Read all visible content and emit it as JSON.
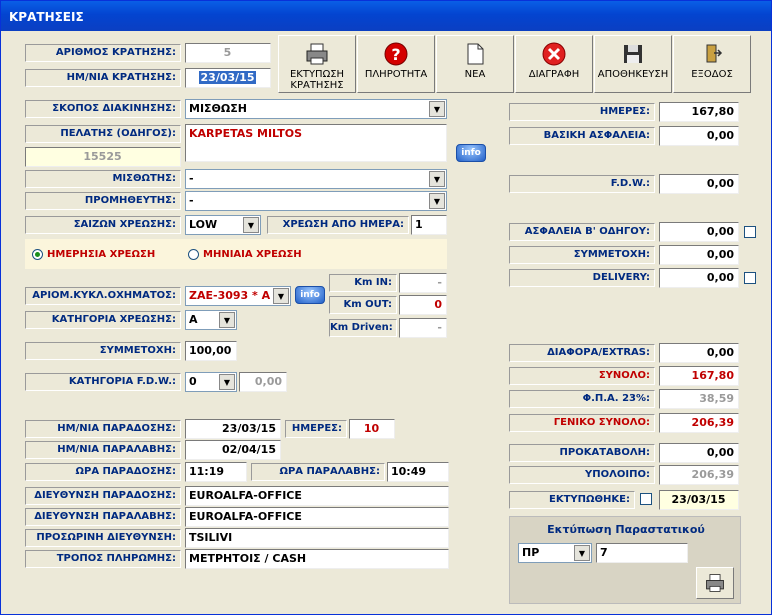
{
  "window": {
    "title": "ΚΡΑΤΗΣΕΙΣ"
  },
  "toolbar": {
    "print": "ΕΚΤΥΠΩΣΗ ΚΡΑΤΗΣΗΣ",
    "help": "ΠΛΗΡΟΤΗΤΑ",
    "new": "ΝΕΑ",
    "delete": "ΔΙΑΓΡΑΦΗ",
    "save": "ΑΠΟΘΗΚΕΥΣΗ",
    "exit": "ΕΞΟΔΟΣ"
  },
  "booking": {
    "num_label": "ΑΡΙΘΜΟΣ ΚΡΑΤΗΣΗΣ:",
    "num": "5",
    "date_label": "ΗΜ/ΝΙΑ ΚΡΑΤΗΣΗΣ:",
    "date": "23/03/15"
  },
  "form": {
    "purpose_label": "ΣΚΟΠΟΣ ΔΙΑΚΙΝΗΣΗΣ:",
    "purpose": "ΜΙΣΘΩΣΗ",
    "customer_label": "ΠΕΛΑΤΗΣ (ΟΔΗΓΟΣ):",
    "customer": "KARPETAS MILTOS",
    "customer_code": "15525",
    "info": "info",
    "lessor_label": "ΜΙΣΘΩΤΗΣ:",
    "lessor": "-",
    "supplier_label": "ΠΡΟΜΗΘΕΥΤΗΣ:",
    "supplier": "-",
    "season_label": "ΣΑΙΖΩΝ ΧΡΕΩΣΗΣ:",
    "season": "LOW",
    "charge_from_label": "ΧΡΕΩΣΗ ΑΠΟ ΗΜΕΡΑ:",
    "charge_from": "1",
    "daily": "ΗΜΕΡΗΣΙΑ ΧΡΕΩΣΗ",
    "monthly": "ΜΗΝΙΑΙΑ ΧΡΕΩΣΗ",
    "plate_label": "ΑΡΙΟΜ.ΚΥΚΛ.ΟΧΗΜΑΤΟΣ:",
    "plate": "ZAE-3093  *  A",
    "category_label": "ΚΑΤΗΓΟΡΙΑ ΧΡΕΩΣΗΣ:",
    "category": "A",
    "km_in_label": "Km IN:",
    "km_in": "-",
    "km_out_label": "Km OUT:",
    "km_out": "0",
    "km_driven_label": "Km Driven:",
    "km_driven": "-",
    "excess_label": "ΣΥΜΜΕΤΟΧΗ:",
    "excess": "100,00",
    "fdw_cat_label": "ΚΑΤΗΓΟΡΙΑ F.D.W.:",
    "fdw_cat": "0",
    "fdw_cat_value": "0,00",
    "delivery_date_label": "ΗΜ/ΝΙΑ ΠΑΡΑΔΟΣΗΣ:",
    "delivery_date": "23/03/15",
    "days_label": "ΗΜΕΡΕΣ:",
    "days": "10",
    "return_date_label": "ΗΜ/ΝΙΑ ΠΑΡΑΛΑΒΗΣ:",
    "return_date": "02/04/15",
    "delivery_time_label": "ΩΡΑ ΠΑΡΑΔΟΣΗΣ:",
    "delivery_time": "11:19",
    "return_time_label": "ΩΡΑ ΠΑΡΑΛΑΒΗΣ:",
    "return_time": "10:49",
    "delivery_addr_label": "ΔΙΕΥΘΥΝΣΗ ΠΑΡΑΔΟΣΗΣ:",
    "delivery_addr": "EUROALFA-OFFICE",
    "return_addr_label": "ΔΙΕΥΘΥΝΣΗ ΠΑΡΑΛΑΒΗΣ:",
    "return_addr": "EUROALFA-OFFICE",
    "temp_addr_label": "ΠΡΟΣΩΡΙΝΗ ΔΙΕΥΘΥΝΣΗ:",
    "temp_addr": "TSILIVI",
    "payment_label": "ΤΡΟΠΟΣ ΠΛΗΡΩΜΗΣ:",
    "payment": "ΜΕΤΡΗΤΟΙΣ / CASH"
  },
  "totals": {
    "days_label": "ΗΜΕΡΕΣ:",
    "days": "167,80",
    "basic_ins_label": "ΒΑΣΙΚΗ ΑΣΦΑΛΕΙΑ:",
    "basic_ins": "0,00",
    "fdw_label": "F.D.W.:",
    "fdw": "0,00",
    "second_driver_label": "ΑΣΦΑΛΕΙΑ Β' ΟΔΗΓΟΥ:",
    "second_driver": "0,00",
    "excess_label": "ΣΥΜΜΕΤΟΧΗ:",
    "excess": "0,00",
    "delivery_label": "DELIVERY:",
    "delivery": "0,00",
    "extras_label": "ΔΙΑΦΟΡΑ/EXTRAS:",
    "extras": "0,00",
    "sum_label": "ΣΥΝΟΛΟ:",
    "sum": "167,80",
    "vat_label": "Φ.Π.Α. 23%:",
    "vat": "38,59",
    "grand_label": "ΓΕΝΙΚΟ ΣΥΝΟΛΟ:",
    "grand": "206,39",
    "deposit_label": "ΠΡΟΚΑΤΑΒΟΛΗ:",
    "deposit": "0,00",
    "balance_label": "ΥΠΟΛΟΙΠΟ:",
    "balance": "206,39",
    "printed_label": "ΕΚΤΥΠΩΘΗΚΕ:",
    "printed_date": "23/03/15"
  },
  "print_doc": {
    "title": "Εκτύπωση Παραστατικού",
    "type": "ΠΡ",
    "number": "7"
  }
}
